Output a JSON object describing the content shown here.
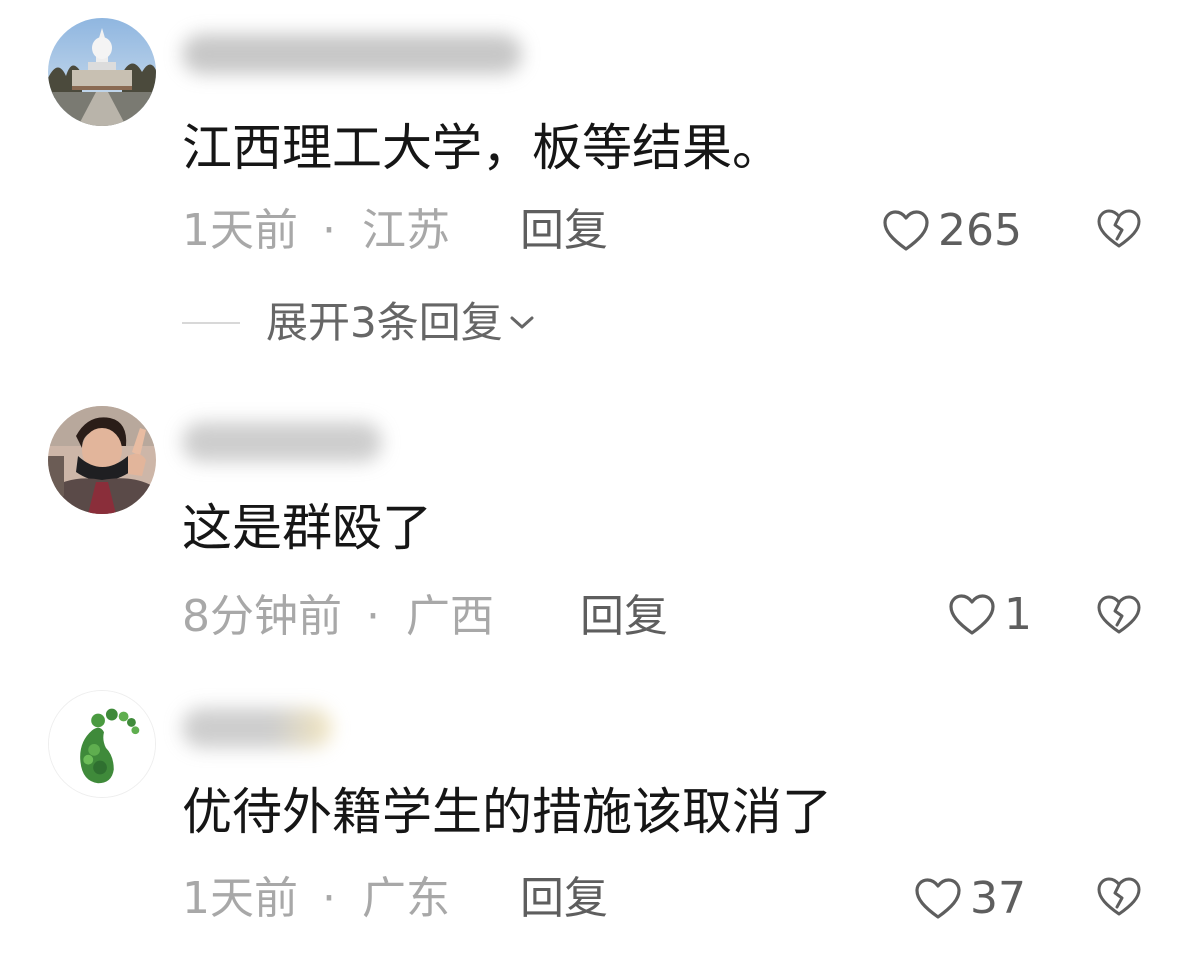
{
  "comments": [
    {
      "content": "江西理工大学，板等结果。",
      "time": "1天前",
      "separator": "·",
      "location": "江苏",
      "reply_label": "回复",
      "likes": "265",
      "avatar": "pagoda-photo-avatar",
      "expand_label": "展开3条回复"
    },
    {
      "content": "这是群殴了",
      "time": "8分钟前",
      "separator": "·",
      "location": "广西",
      "reply_label": "回复",
      "likes": "1",
      "avatar": "person-selfie-avatar"
    },
    {
      "content": "优待外籍学生的措施该取消了",
      "time": "1天前",
      "separator": "·",
      "location": "广东",
      "reply_label": "回复",
      "likes": "37",
      "avatar": "green-footprint-avatar"
    }
  ],
  "icons": {
    "like": "heart-outline-icon",
    "dislike": "broken-heart-icon",
    "expand": "chevron-down-icon"
  },
  "colors": {
    "text": "#161616",
    "meta": "#a8a8a8",
    "action": "#5e5e5e",
    "background": "#ffffff"
  }
}
